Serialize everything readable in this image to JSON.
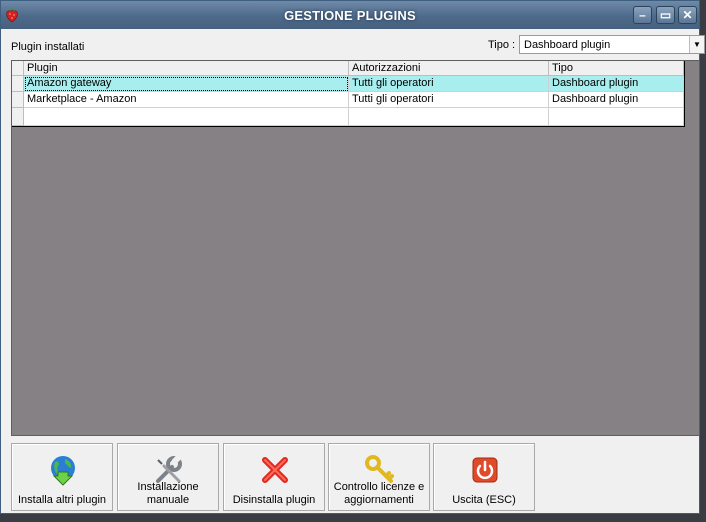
{
  "window": {
    "title": "GESTIONE PLUGINS",
    "controls": [
      "minimize",
      "maximize",
      "close"
    ]
  },
  "labels": {
    "installed": "Plugin installati",
    "tipo": "Tipo :"
  },
  "tipo_select": {
    "value": "Dashboard plugin"
  },
  "table": {
    "columns": [
      "Plugin",
      "Autorizzazioni",
      "Tipo"
    ],
    "rows": [
      [
        "Amazon gateway",
        "Tutti gli operatori",
        "Dashboard plugin"
      ],
      [
        "Marketplace - Amazon",
        "Tutti gli operatori",
        "Dashboard plugin"
      ],
      [
        "",
        "",
        ""
      ]
    ],
    "selected_row": 0
  },
  "buttons": {
    "install_more": "Installa altri plugin",
    "manual_install": "Installazione manuale",
    "uninstall": "Disinstalla plugin",
    "license_check": "Controllo licenze e aggiornamenti",
    "exit": "Uscita (ESC)"
  },
  "icons": {
    "install_more": "globe-download-icon",
    "manual_install": "wrench-screwdriver-icon",
    "uninstall": "red-x-icon",
    "license_check": "key-icon",
    "exit": "power-icon"
  },
  "colors": {
    "titlebar": "#5a7696",
    "selected_row": "#a8eeee",
    "grid_background": "#858184"
  }
}
